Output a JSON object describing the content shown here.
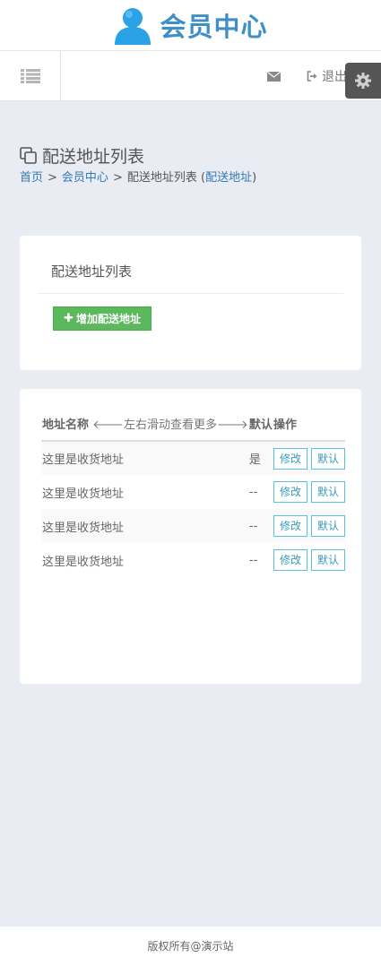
{
  "header": {
    "title": "会员中心"
  },
  "toolbar": {
    "logout_label": "退出"
  },
  "page": {
    "title": "配送地址列表",
    "breadcrumb": {
      "home": "首页",
      "member": "会员中心",
      "current": "配送地址列表",
      "sub_link": "配送地址"
    }
  },
  "panel": {
    "title": "配送地址列表",
    "add_button": "增加配送地址"
  },
  "table": {
    "headers": {
      "name": "地址名称",
      "scroll_hint": "左右滑动查看更多",
      "default": "默认",
      "actions": "操作"
    },
    "rows": [
      {
        "name": "这里是收货地址",
        "default": "是",
        "edit": "修改",
        "set_default": "默认"
      },
      {
        "name": "这里是收货地址",
        "default": "--",
        "edit": "修改",
        "set_default": "默认"
      },
      {
        "name": "这里是收货地址",
        "default": "--",
        "edit": "修改",
        "set_default": "默认"
      },
      {
        "name": "这里是收货地址",
        "default": "--",
        "edit": "修改",
        "set_default": "默认"
      }
    ]
  },
  "footer": {
    "text": "版权所有@演示站"
  },
  "colors": {
    "brand": "#3f8fc7",
    "link": "#3279b7",
    "success": "#5cb85c",
    "info": "#5bc0de",
    "background": "#e9ecf3"
  }
}
